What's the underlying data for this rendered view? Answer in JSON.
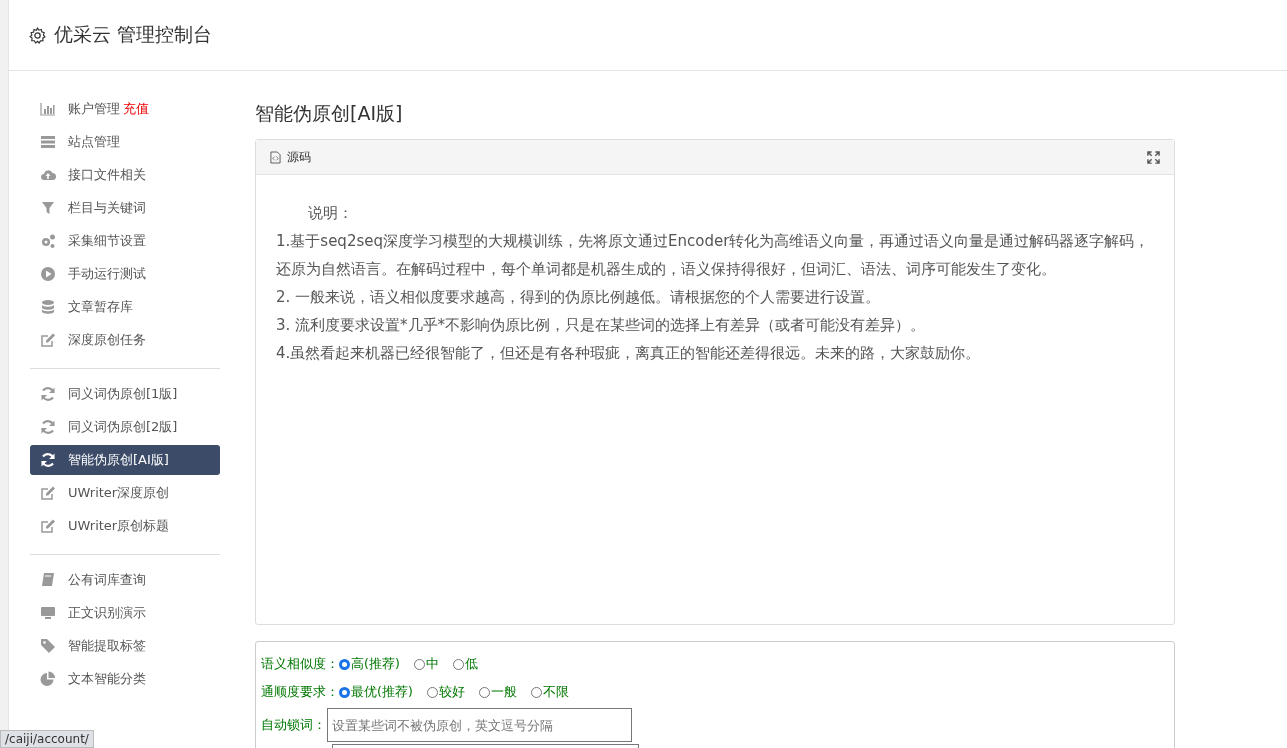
{
  "header": {
    "title": "优采云 管理控制台"
  },
  "sidebar": {
    "groups": [
      {
        "items": [
          {
            "label": "账户管理",
            "badge": "充值",
            "kind": "chart",
            "selected": false
          },
          {
            "label": "站点管理",
            "kind": "server",
            "selected": false
          },
          {
            "label": "接口文件相关",
            "kind": "cloud",
            "selected": false
          },
          {
            "label": "栏目与关键词",
            "kind": "filter",
            "selected": false
          },
          {
            "label": "采集细节设置",
            "kind": "gears",
            "selected": false
          },
          {
            "label": "手动运行测试",
            "kind": "play",
            "selected": false
          },
          {
            "label": "文章暂存库",
            "kind": "database",
            "selected": false
          },
          {
            "label": "深度原创任务",
            "kind": "edit",
            "selected": false
          }
        ]
      },
      {
        "items": [
          {
            "label": "同义词伪原创[1版]",
            "kind": "refresh",
            "selected": false
          },
          {
            "label": "同义词伪原创[2版]",
            "kind": "refresh",
            "selected": false
          },
          {
            "label": "智能伪原创[AI版]",
            "kind": "refresh",
            "selected": true
          },
          {
            "label": "UWriter深度原创",
            "kind": "edit",
            "selected": false
          },
          {
            "label": "UWriter原创标题",
            "kind": "edit",
            "selected": false
          }
        ]
      },
      {
        "items": [
          {
            "label": "公有词库查询",
            "kind": "book",
            "selected": false
          },
          {
            "label": "正文识别演示",
            "kind": "monitor",
            "selected": false
          },
          {
            "label": "智能提取标签",
            "kind": "tag",
            "selected": false
          },
          {
            "label": "文本智能分类",
            "kind": "pie",
            "selected": false
          }
        ]
      }
    ]
  },
  "page_title": "智能伪原创[AI版]",
  "editor": {
    "toolbar_label": "源码",
    "paragraphs": [
      "说明：",
      "1.基于seq2seq深度学习模型的大规模训练，先将原文通过Encoder转化为高维语义向量，再通过语义向量是通过解码器逐字解码，还原为自然语言。在解码过程中，每个单词都是机器生成的，语义保持得很好，但词汇、语法、词序可能发生了变化。",
      "2. 一般来说，语义相似度要求越高，得到的伪原比例越低。请根据您的个人需要进行设置。",
      "3. 流利度要求设置*几乎*不影响伪原比例，只是在某些词的选择上有差异（或者可能没有差异）。",
      "4.虽然看起来机器已经很智能了，但还是有各种瑕疵，离真正的智能还差得很远。未来的路，大家鼓励你。"
    ]
  },
  "options": {
    "radio_groups": [
      {
        "label": "语义相似度：",
        "choices": [
          {
            "label": "高(推荐)",
            "selected": true
          },
          {
            "label": "中",
            "selected": false
          },
          {
            "label": "低",
            "selected": false
          }
        ]
      },
      {
        "label": "通顺度要求：",
        "choices": [
          {
            "label": "最优(推荐)",
            "selected": true
          },
          {
            "label": "较好",
            "selected": false
          },
          {
            "label": "一般",
            "selected": false
          },
          {
            "label": "不限",
            "selected": false
          }
        ]
      }
    ],
    "lock_words": {
      "label": "自动锁词：",
      "placeholder": "设置某些词不被伪原创，英文逗号分隔"
    }
  },
  "status_bar": {
    "url": "/caiji/account/"
  }
}
